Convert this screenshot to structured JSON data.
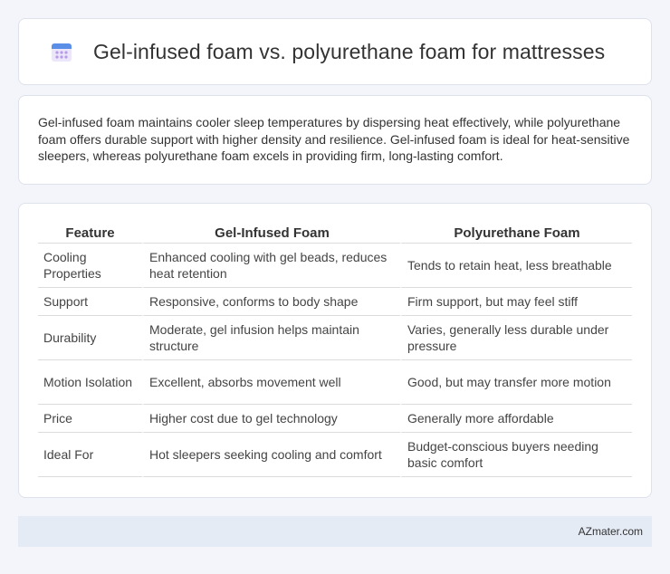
{
  "header": {
    "title": "Gel-infused foam vs. polyurethane foam for mattresses",
    "icon": "calendar-icon",
    "icon_color": "#8f6bd6"
  },
  "summary": {
    "text": "Gel-infused foam maintains cooler sleep temperatures by dispersing heat effectively, while polyurethane foam offers durable support with higher density and resilience. Gel-infused foam is ideal for heat-sensitive sleepers, whereas polyurethane foam excels in providing firm, long-lasting comfort."
  },
  "table": {
    "headers": [
      "Feature",
      "Gel-Infused Foam",
      "Polyurethane Foam"
    ],
    "rows": [
      [
        "Cooling Properties",
        "Enhanced cooling with gel beads, reduces heat retention",
        "Tends to retain heat, less breathable"
      ],
      [
        "Support",
        "Responsive, conforms to body shape",
        "Firm support, but may feel stiff"
      ],
      [
        "Durability",
        "Moderate, gel infusion helps maintain structure",
        "Varies, generally less durable under pressure"
      ],
      [
        "Motion Isolation",
        "Excellent, absorbs movement well",
        "Good, but may transfer more motion"
      ],
      [
        "Price",
        "Higher cost due to gel technology",
        "Generally more affordable"
      ],
      [
        "Ideal For",
        "Hot sleepers seeking cooling and comfort",
        "Budget-conscious buyers needing basic comfort"
      ]
    ]
  },
  "footer": {
    "text": "AZmater.com"
  }
}
